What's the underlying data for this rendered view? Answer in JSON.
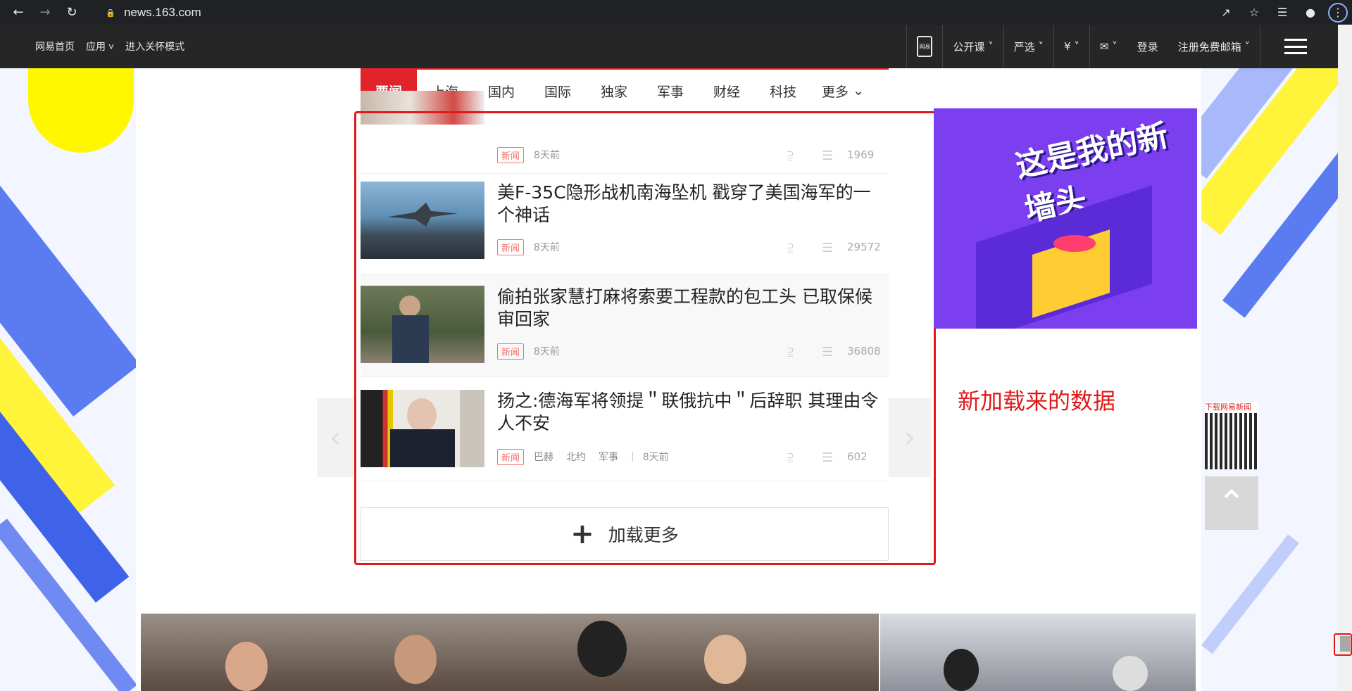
{
  "browser": {
    "url": "news.163.com"
  },
  "topbar": {
    "left_links": [
      "网易首页",
      "应用",
      "进入关怀模式"
    ],
    "right_items": [
      "公开课",
      "严选",
      "登录",
      "注册免费邮箱"
    ],
    "phone_label": "网易"
  },
  "tabs": [
    "要闻",
    "上海",
    "国内",
    "国际",
    "独家",
    "军事",
    "财经",
    "科技",
    "更多"
  ],
  "feed": [
    {
      "title": "",
      "badge": "新闻",
      "tags": [],
      "time": "8天前",
      "comments": "1969"
    },
    {
      "title": "美F-35C隐形战机南海坠机 戳穿了美国海军的一个神话",
      "badge": "新闻",
      "tags": [],
      "time": "8天前",
      "comments": "29572"
    },
    {
      "title": "偷拍张家慧打麻将索要工程款的包工头 已取保候审回家",
      "badge": "新闻",
      "tags": [],
      "time": "8天前",
      "comments": "36808"
    },
    {
      "title": "扬之:德海军将领提＂联俄抗中＂后辞职 其理由令人不安",
      "badge": "新闻",
      "tags": [
        "巴赫",
        "北约",
        "军事"
      ],
      "time": "8天前",
      "comments": "602"
    }
  ],
  "load_more": "加载更多",
  "annotation": "新加载来的数据",
  "ad": {
    "title": "这是我的新墙头"
  },
  "qr": {
    "label": "下载网易新闻"
  }
}
